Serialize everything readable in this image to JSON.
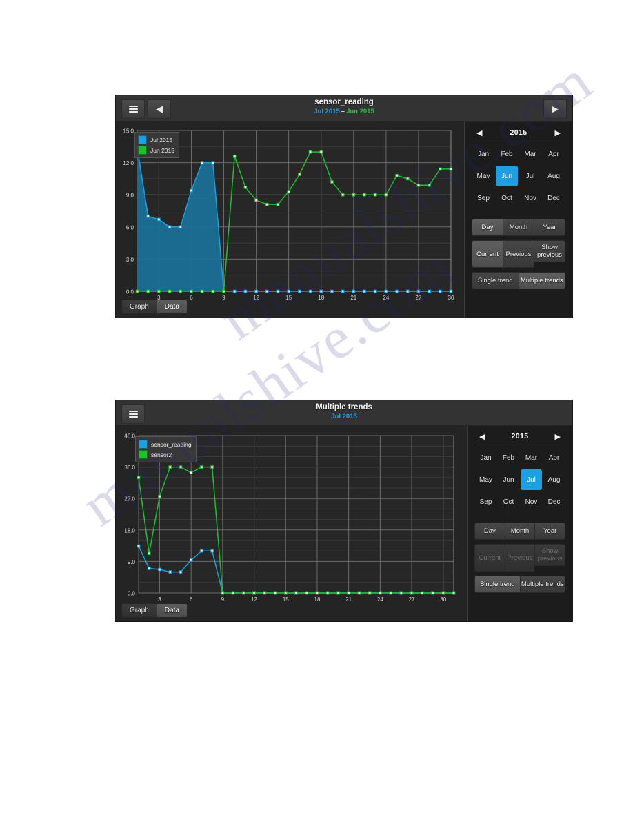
{
  "page": {
    "background": "#ffffff"
  },
  "watermark": {
    "text": "manualshive.com"
  },
  "colors": {
    "series_blue": "#1f9fe0",
    "series_green": "#1fc02f",
    "accent": "#1e9fe2",
    "panel_bg": "#1c1c1c",
    "plot_bg": "#242424",
    "titlebar_bg": "#333333",
    "grid": "#5a5a5a"
  },
  "screens": [
    {
      "id": "single-trend",
      "titlebar": {
        "menu_icon": "hamburger-icon",
        "prev_icon": "chevron-left-icon",
        "next_icon": "chevron-right-icon",
        "title": "sensor_reading",
        "subtitle_primary": "Jul 2015",
        "subtitle_dash": "–",
        "subtitle_secondary": "Jun 2015"
      },
      "legend": [
        {
          "label": "Jul 2015",
          "color": "#1f9fe0"
        },
        {
          "label": "Jun 2015",
          "color": "#1fc02f"
        }
      ],
      "graph_tabs": [
        {
          "label": "Graph",
          "active": false
        },
        {
          "label": "Data",
          "active": true
        }
      ],
      "side": {
        "year_prev_icon": "chevron-left-icon",
        "year": "2015",
        "year_next_icon": "chevron-right-icon",
        "months": [
          "Jan",
          "Feb",
          "Mar",
          "Apr",
          "May",
          "Jun",
          "Jul",
          "Aug",
          "Sep",
          "Oct",
          "Nov",
          "Dec"
        ],
        "selected_month": "Jun",
        "range_buttons": [
          {
            "label": "Day",
            "active": true,
            "disabled": false
          },
          {
            "label": "Month",
            "active": false,
            "disabled": false
          },
          {
            "label": "Year",
            "active": false,
            "disabled": false
          }
        ],
        "compare_buttons": [
          {
            "label": "Current",
            "active": true,
            "disabled": false
          },
          {
            "label": "Previous",
            "active": false,
            "disabled": false
          },
          {
            "label": "Show previous",
            "active": false,
            "disabled": false
          }
        ],
        "trend_buttons": [
          {
            "label": "Single trend",
            "active": false,
            "disabled": false
          },
          {
            "label": "Multiple trends",
            "active": true,
            "disabled": false
          }
        ]
      },
      "chart_data": {
        "type": "area",
        "title": "sensor_reading",
        "xlabel": "",
        "ylabel": "",
        "xlim": [
          1,
          30
        ],
        "ylim": [
          0,
          15
        ],
        "yticks": [
          "0.0",
          "3.0",
          "6.0",
          "9.0",
          "12.0",
          "15.0"
        ],
        "xticks": [
          3,
          6,
          9,
          12,
          15,
          18,
          21,
          24,
          27,
          30
        ],
        "grid": true,
        "legend_position": "top-left",
        "x": [
          1,
          2,
          3,
          4,
          5,
          6,
          7,
          8,
          9,
          10,
          11,
          12,
          13,
          14,
          15,
          16,
          17,
          18,
          19,
          20,
          21,
          22,
          23,
          24,
          25,
          26,
          27,
          28,
          29,
          30
        ],
        "series": [
          {
            "name": "Jul 2015",
            "color": "#1f9fe0",
            "fill": true,
            "values": [
              13.4,
              7.0,
              6.7,
              6.0,
              6.0,
              9.4,
              12.0,
              12.0,
              0,
              0,
              0,
              0,
              0,
              0,
              0,
              0,
              0,
              0,
              0,
              0,
              0,
              0,
              0,
              0,
              0,
              0,
              0,
              0,
              0,
              0
            ]
          },
          {
            "name": "Jun 2015",
            "color": "#1fc02f",
            "fill": false,
            "values": [
              0,
              0,
              0,
              0,
              0,
              0,
              0,
              0,
              0,
              12.6,
              9.7,
              8.5,
              8.1,
              8.1,
              9.3,
              10.9,
              13.0,
              13.0,
              10.2,
              9.0,
              9.0,
              9.0,
              9.0,
              9.0,
              10.8,
              10.5,
              9.9,
              9.9,
              11.4,
              11.4
            ]
          }
        ]
      }
    },
    {
      "id": "multiple-trends",
      "titlebar": {
        "menu_icon": "hamburger-icon",
        "title": "Multiple trends",
        "subtitle_primary": "Jul 2015",
        "subtitle_dash": "",
        "subtitle_secondary": ""
      },
      "legend": [
        {
          "label": "sensor_reading",
          "color": "#1f9fe0"
        },
        {
          "label": "sensor2",
          "color": "#1fc02f"
        }
      ],
      "graph_tabs": [
        {
          "label": "Graph",
          "active": false
        },
        {
          "label": "Data",
          "active": true
        }
      ],
      "side": {
        "year_prev_icon": "chevron-left-icon",
        "year": "2015",
        "year_next_icon": "chevron-right-icon",
        "months": [
          "Jan",
          "Feb",
          "Mar",
          "Apr",
          "May",
          "Jun",
          "Jul",
          "Aug",
          "Sep",
          "Oct",
          "Nov",
          "Dec"
        ],
        "selected_month": "Jul",
        "range_buttons": [
          {
            "label": "Day",
            "active": false,
            "disabled": false
          },
          {
            "label": "Month",
            "active": false,
            "disabled": false
          },
          {
            "label": "Year",
            "active": false,
            "disabled": false
          }
        ],
        "compare_buttons": [
          {
            "label": "Current",
            "active": false,
            "disabled": true
          },
          {
            "label": "Previous",
            "active": false,
            "disabled": true
          },
          {
            "label": "Show previous",
            "active": false,
            "disabled": true
          }
        ],
        "trend_buttons": [
          {
            "label": "Single trend",
            "active": true,
            "disabled": false
          },
          {
            "label": "Multiple trends",
            "active": false,
            "disabled": false
          }
        ]
      },
      "chart_data": {
        "type": "line",
        "title": "Multiple trends",
        "xlabel": "",
        "ylabel": "",
        "xlim": [
          1,
          31
        ],
        "ylim": [
          0,
          45
        ],
        "yticks": [
          "0.0",
          "9.0",
          "18.0",
          "27.0",
          "36.0",
          "45.0"
        ],
        "xticks": [
          3,
          6,
          9,
          12,
          15,
          18,
          21,
          24,
          27,
          30
        ],
        "grid": true,
        "legend_position": "top-left",
        "x": [
          1,
          2,
          3,
          4,
          5,
          6,
          7,
          8,
          9,
          10,
          11,
          12,
          13,
          14,
          15,
          16,
          17,
          18,
          19,
          20,
          21,
          22,
          23,
          24,
          25,
          26,
          27,
          28,
          29,
          30,
          31
        ],
        "series": [
          {
            "name": "sensor_reading",
            "color": "#1f9fe0",
            "fill": false,
            "values": [
              13.4,
              7.0,
              6.7,
              6.0,
              6.0,
              9.4,
              12.0,
              12.0,
              0,
              0,
              0,
              0,
              0,
              0,
              0,
              0,
              0,
              0,
              0,
              0,
              0,
              0,
              0,
              0,
              0,
              0,
              0,
              0,
              0,
              0,
              0
            ]
          },
          {
            "name": "sensor2",
            "color": "#1fc02f",
            "fill": false,
            "values": [
              33.0,
              11.3,
              27.6,
              36.0,
              36.0,
              34.4,
              36.0,
              36.0,
              0,
              0,
              0,
              0,
              0,
              0,
              0,
              0,
              0,
              0,
              0,
              0,
              0,
              0,
              0,
              0,
              0,
              0,
              0,
              0,
              0,
              0,
              0
            ]
          }
        ]
      }
    }
  ]
}
